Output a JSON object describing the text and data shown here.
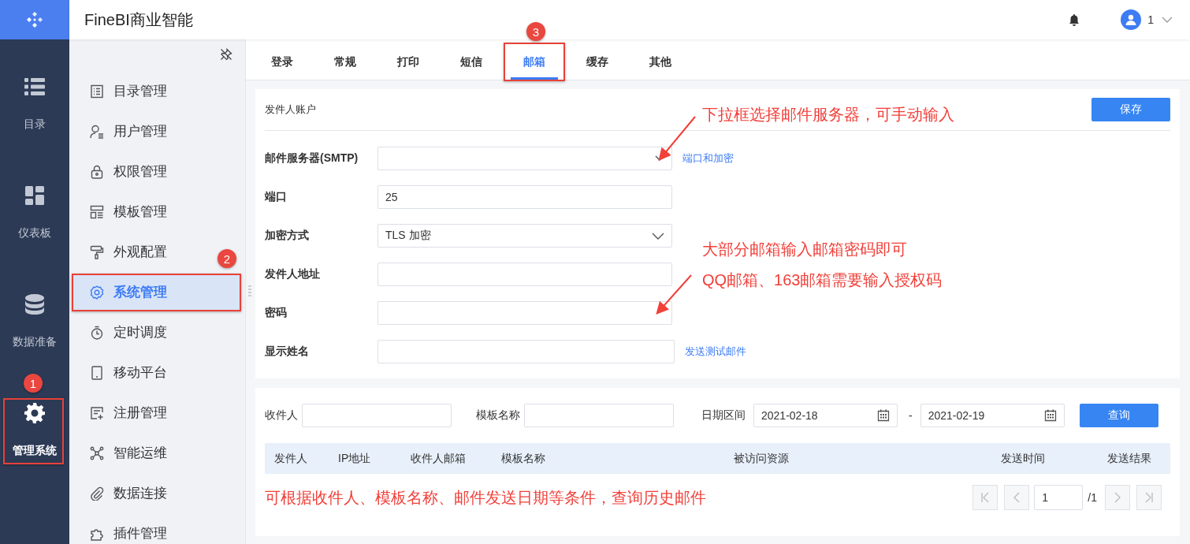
{
  "app_title": "FineBI商业智能",
  "user": {
    "name": "1"
  },
  "rail": [
    {
      "label": "目录",
      "selected": false
    },
    {
      "label": "仪表板",
      "selected": false
    },
    {
      "label": "数据准备",
      "selected": false
    },
    {
      "label": "管理系统",
      "selected": true
    }
  ],
  "menu": [
    {
      "label": "目录管理",
      "selected": false
    },
    {
      "label": "用户管理",
      "selected": false
    },
    {
      "label": "权限管理",
      "selected": false
    },
    {
      "label": "模板管理",
      "selected": false
    },
    {
      "label": "外观配置",
      "selected": false
    },
    {
      "label": "系统管理",
      "selected": true
    },
    {
      "label": "定时调度",
      "selected": false
    },
    {
      "label": "移动平台",
      "selected": false
    },
    {
      "label": "注册管理",
      "selected": false
    },
    {
      "label": "智能运维",
      "selected": false
    },
    {
      "label": "数据连接",
      "selected": false
    },
    {
      "label": "插件管理",
      "selected": false
    }
  ],
  "tabs": [
    {
      "label": "登录",
      "selected": false
    },
    {
      "label": "常规",
      "selected": false
    },
    {
      "label": "打印",
      "selected": false
    },
    {
      "label": "短信",
      "selected": false
    },
    {
      "label": "邮箱",
      "selected": true
    },
    {
      "label": "缓存",
      "selected": false
    },
    {
      "label": "其他",
      "selected": false
    }
  ],
  "sender_account": {
    "title": "发件人账户",
    "save_button": "保存",
    "fields": [
      {
        "label": "邮件服务器(SMTP)",
        "kind": "combo",
        "link": "端口和加密"
      },
      {
        "label": "端口",
        "kind": "text",
        "value": "25"
      },
      {
        "label": "加密方式",
        "kind": "select",
        "value": "TLS 加密"
      },
      {
        "label": "发件人地址",
        "kind": "text"
      },
      {
        "label": "密码",
        "kind": "text"
      },
      {
        "label": "显示姓名",
        "kind": "text",
        "link": "发送测试邮件"
      }
    ]
  },
  "mail_log": {
    "recipient_label": "收件人",
    "template_label": "模板名称",
    "date_label": "日期区间",
    "date_from": "2021-02-18",
    "date_separator": "-",
    "date_to": "2021-02-19",
    "query_button": "查询",
    "columns": [
      "发件人",
      "IP地址",
      "收件人邮箱",
      "模板名称",
      "被访问资源",
      "发送时间",
      "发送结果"
    ],
    "hint": "可根据收件人、模板名称、邮件发送日期等条件，查询历史邮件",
    "pager": {
      "page": "1",
      "total": "/1"
    }
  },
  "annotations": {
    "callouts": [
      "1",
      "2",
      "3"
    ],
    "notes": [
      "下拉框选择邮件服务器，可手动输入",
      "大部分邮箱输入邮箱密码即可",
      "QQ邮箱、163邮箱需要输入授权码"
    ]
  }
}
